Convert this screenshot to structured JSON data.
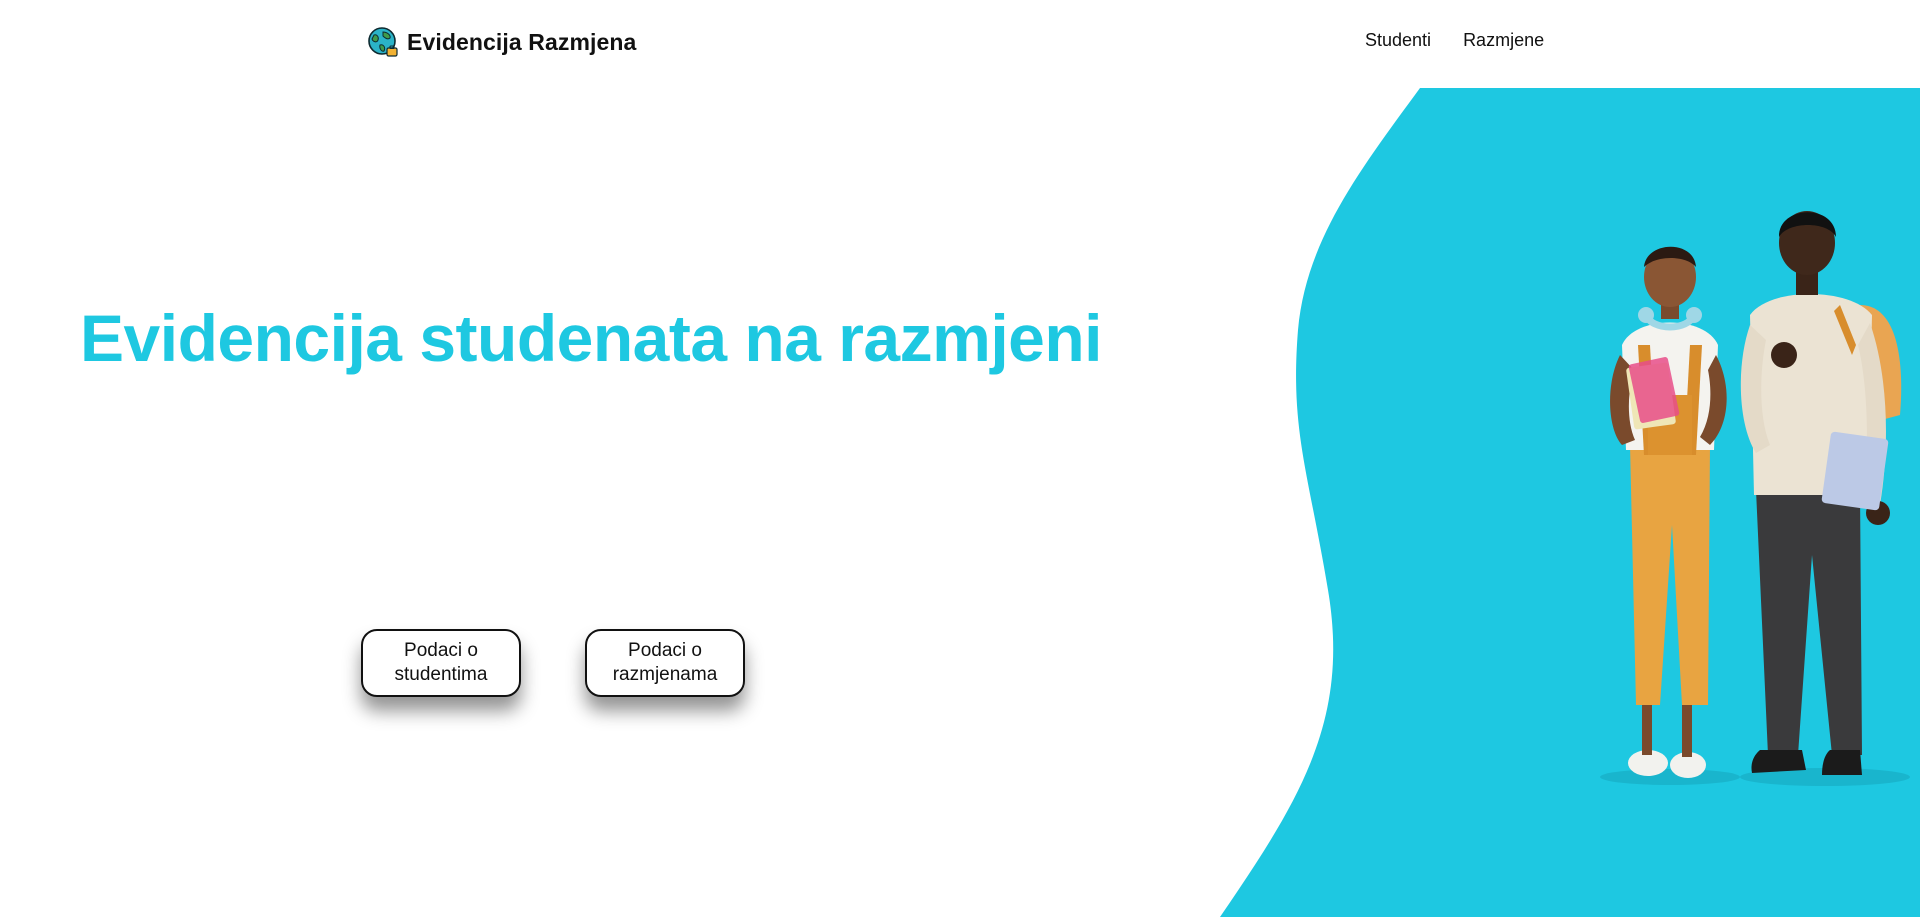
{
  "navbar": {
    "brand_title": "Evidencija Razmjena",
    "logo_icon": "globe-icon",
    "links": [
      {
        "label": "Studenti"
      },
      {
        "label": "Razmjene"
      }
    ]
  },
  "hero": {
    "title": "Evidencija studenata na razmjeni",
    "buttons": [
      {
        "label": "Podaci o studentima"
      },
      {
        "label": "Podaci o razmjenama"
      }
    ],
    "illustration": "two-students-illustration"
  },
  "colors": {
    "accent": "#1ec8e1",
    "text": "#111111",
    "background": "#ffffff"
  }
}
